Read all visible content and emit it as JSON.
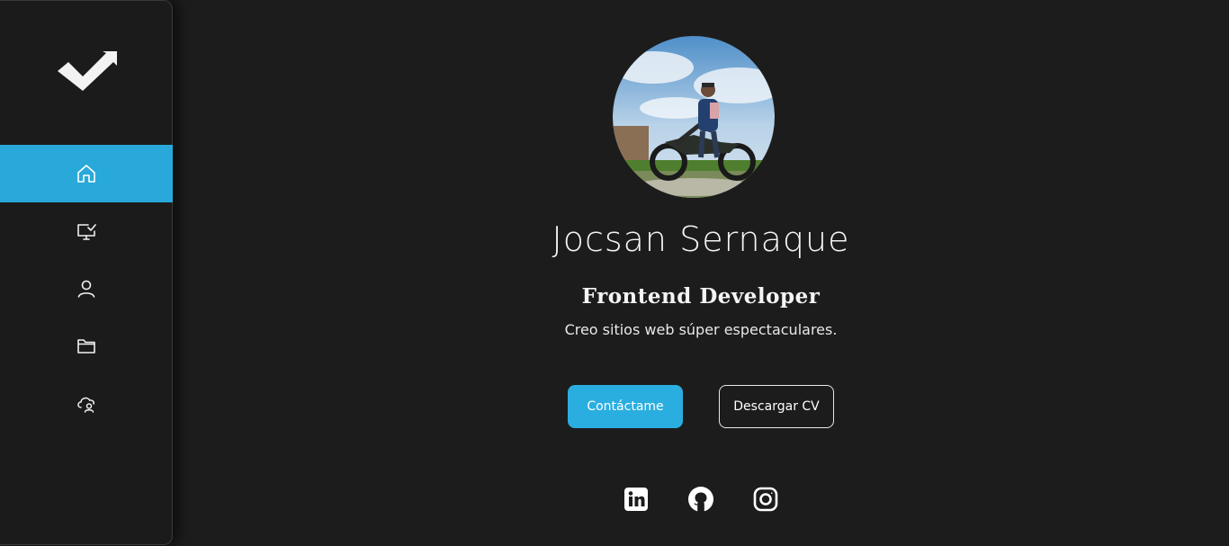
{
  "sidebar": {
    "logo": "checkmark-logo",
    "items": [
      {
        "icon": "home-icon",
        "active": true
      },
      {
        "icon": "monitor-check-icon",
        "active": false
      },
      {
        "icon": "user-icon",
        "active": false
      },
      {
        "icon": "folder-icon",
        "active": false
      },
      {
        "icon": "cloud-user-icon",
        "active": false
      }
    ],
    "accent_color": "#29a9d9"
  },
  "profile": {
    "name": "Jocsan Sernaque",
    "role": "Frontend Developer",
    "tagline": "Creo sitios web súper espectaculares.",
    "avatar": "profile-photo"
  },
  "actions": {
    "contact_label": "Contáctame",
    "cv_label": "Descargar CV"
  },
  "social": [
    {
      "icon": "linkedin-icon"
    },
    {
      "icon": "github-icon"
    },
    {
      "icon": "instagram-icon"
    }
  ],
  "colors": {
    "background": "#1c1c1c",
    "accent": "#2aaee0",
    "text": "#f4f4f4"
  }
}
